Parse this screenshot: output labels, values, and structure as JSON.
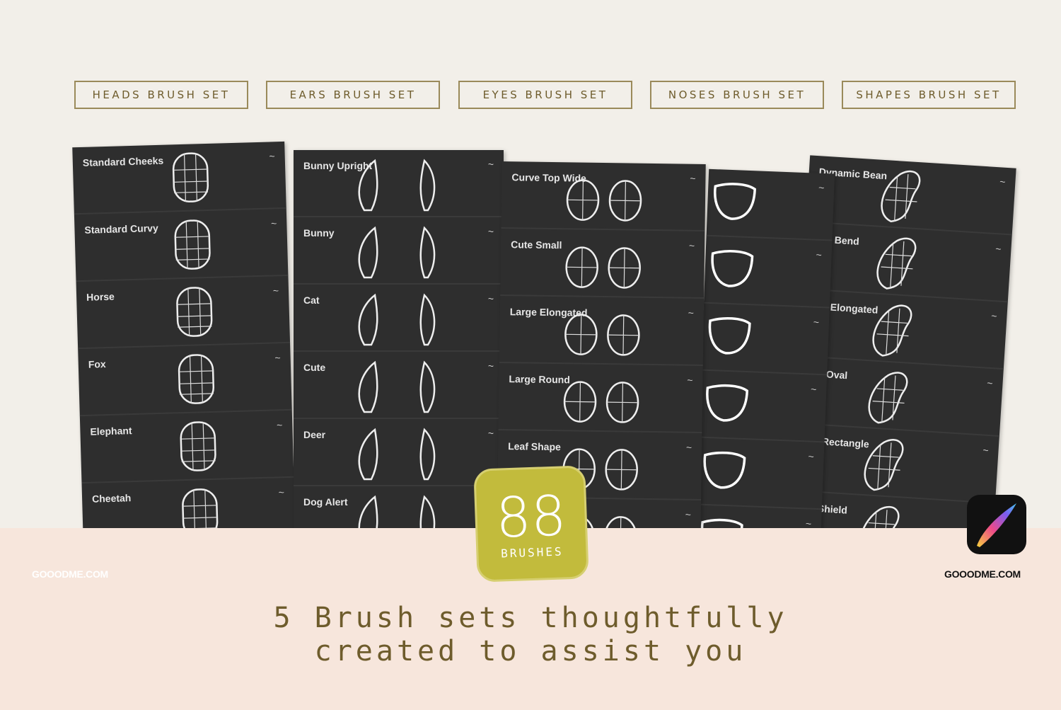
{
  "sets": [
    "Heads brush set",
    "Ears brush set",
    "Eyes brush set",
    "Noses brush set",
    "Shapes brush set"
  ],
  "panels": [
    {
      "name": "heads",
      "rows": [
        {
          "label": "Standard Cheeks",
          "icon": "head-grid-icon"
        },
        {
          "label": "Standard Curvy",
          "icon": "head-grid-icon"
        },
        {
          "label": "Horse",
          "icon": "head-grid-icon"
        },
        {
          "label": "Fox",
          "icon": "head-grid-icon"
        },
        {
          "label": "Elephant",
          "icon": "head-grid-icon"
        },
        {
          "label": "Cheetah",
          "icon": "head-grid-icon"
        }
      ]
    },
    {
      "name": "ears",
      "rows": [
        {
          "label": "Bunny Upright",
          "icon": "ears-icon"
        },
        {
          "label": "Bunny",
          "icon": "ears-icon"
        },
        {
          "label": "Cat",
          "icon": "ears-icon"
        },
        {
          "label": "Cute",
          "icon": "ears-icon"
        },
        {
          "label": "Deer",
          "icon": "ears-icon"
        },
        {
          "label": "Dog Alert",
          "icon": "ears-icon"
        }
      ]
    },
    {
      "name": "eyes",
      "rows": [
        {
          "label": "Curve Top Wide",
          "icon": "eyes-icon"
        },
        {
          "label": "Cute Small",
          "icon": "eyes-icon"
        },
        {
          "label": "Large Elongated",
          "icon": "eyes-icon"
        },
        {
          "label": "Large Round",
          "icon": "eyes-icon"
        },
        {
          "label": "Leaf Shape",
          "icon": "eyes-icon"
        },
        {
          "label": "",
          "icon": "eyes-icon"
        }
      ]
    },
    {
      "name": "noses",
      "rows": [
        {
          "label": "",
          "icon": "nose-icon"
        },
        {
          "label": "",
          "icon": "nose-icon"
        },
        {
          "label": "",
          "icon": "nose-icon"
        },
        {
          "label": "",
          "icon": "nose-icon"
        },
        {
          "label": "",
          "icon": "nose-icon"
        },
        {
          "label": "",
          "icon": "nose-icon"
        }
      ]
    },
    {
      "name": "shapes",
      "rows": [
        {
          "label": "Dynamic Bean",
          "icon": "shape-grid-icon"
        },
        {
          "label": "mic Bend",
          "icon": "shape-grid-icon"
        },
        {
          "label": "mic Elongated",
          "icon": "shape-grid-icon"
        },
        {
          "label": "mic Oval",
          "icon": "shape-grid-icon"
        },
        {
          "label": "mic Rectangle",
          "icon": "shape-grid-icon"
        },
        {
          "label": "mic Shield",
          "icon": "shape-grid-icon"
        }
      ]
    }
  ],
  "badge": {
    "number": "88",
    "label": "BRUSHES",
    "color": "#c2bb3c"
  },
  "watermark_left": "GOOODME.COM",
  "watermark_right": "GOOODME.COM",
  "tagline": {
    "line1": "5 Brush sets thoughtfully",
    "line2": "created to assist you"
  },
  "colors": {
    "background": "#f2efe9",
    "band": "#f7e6dc",
    "panel": "#2e2e2e",
    "text": "#6e5c2c"
  }
}
